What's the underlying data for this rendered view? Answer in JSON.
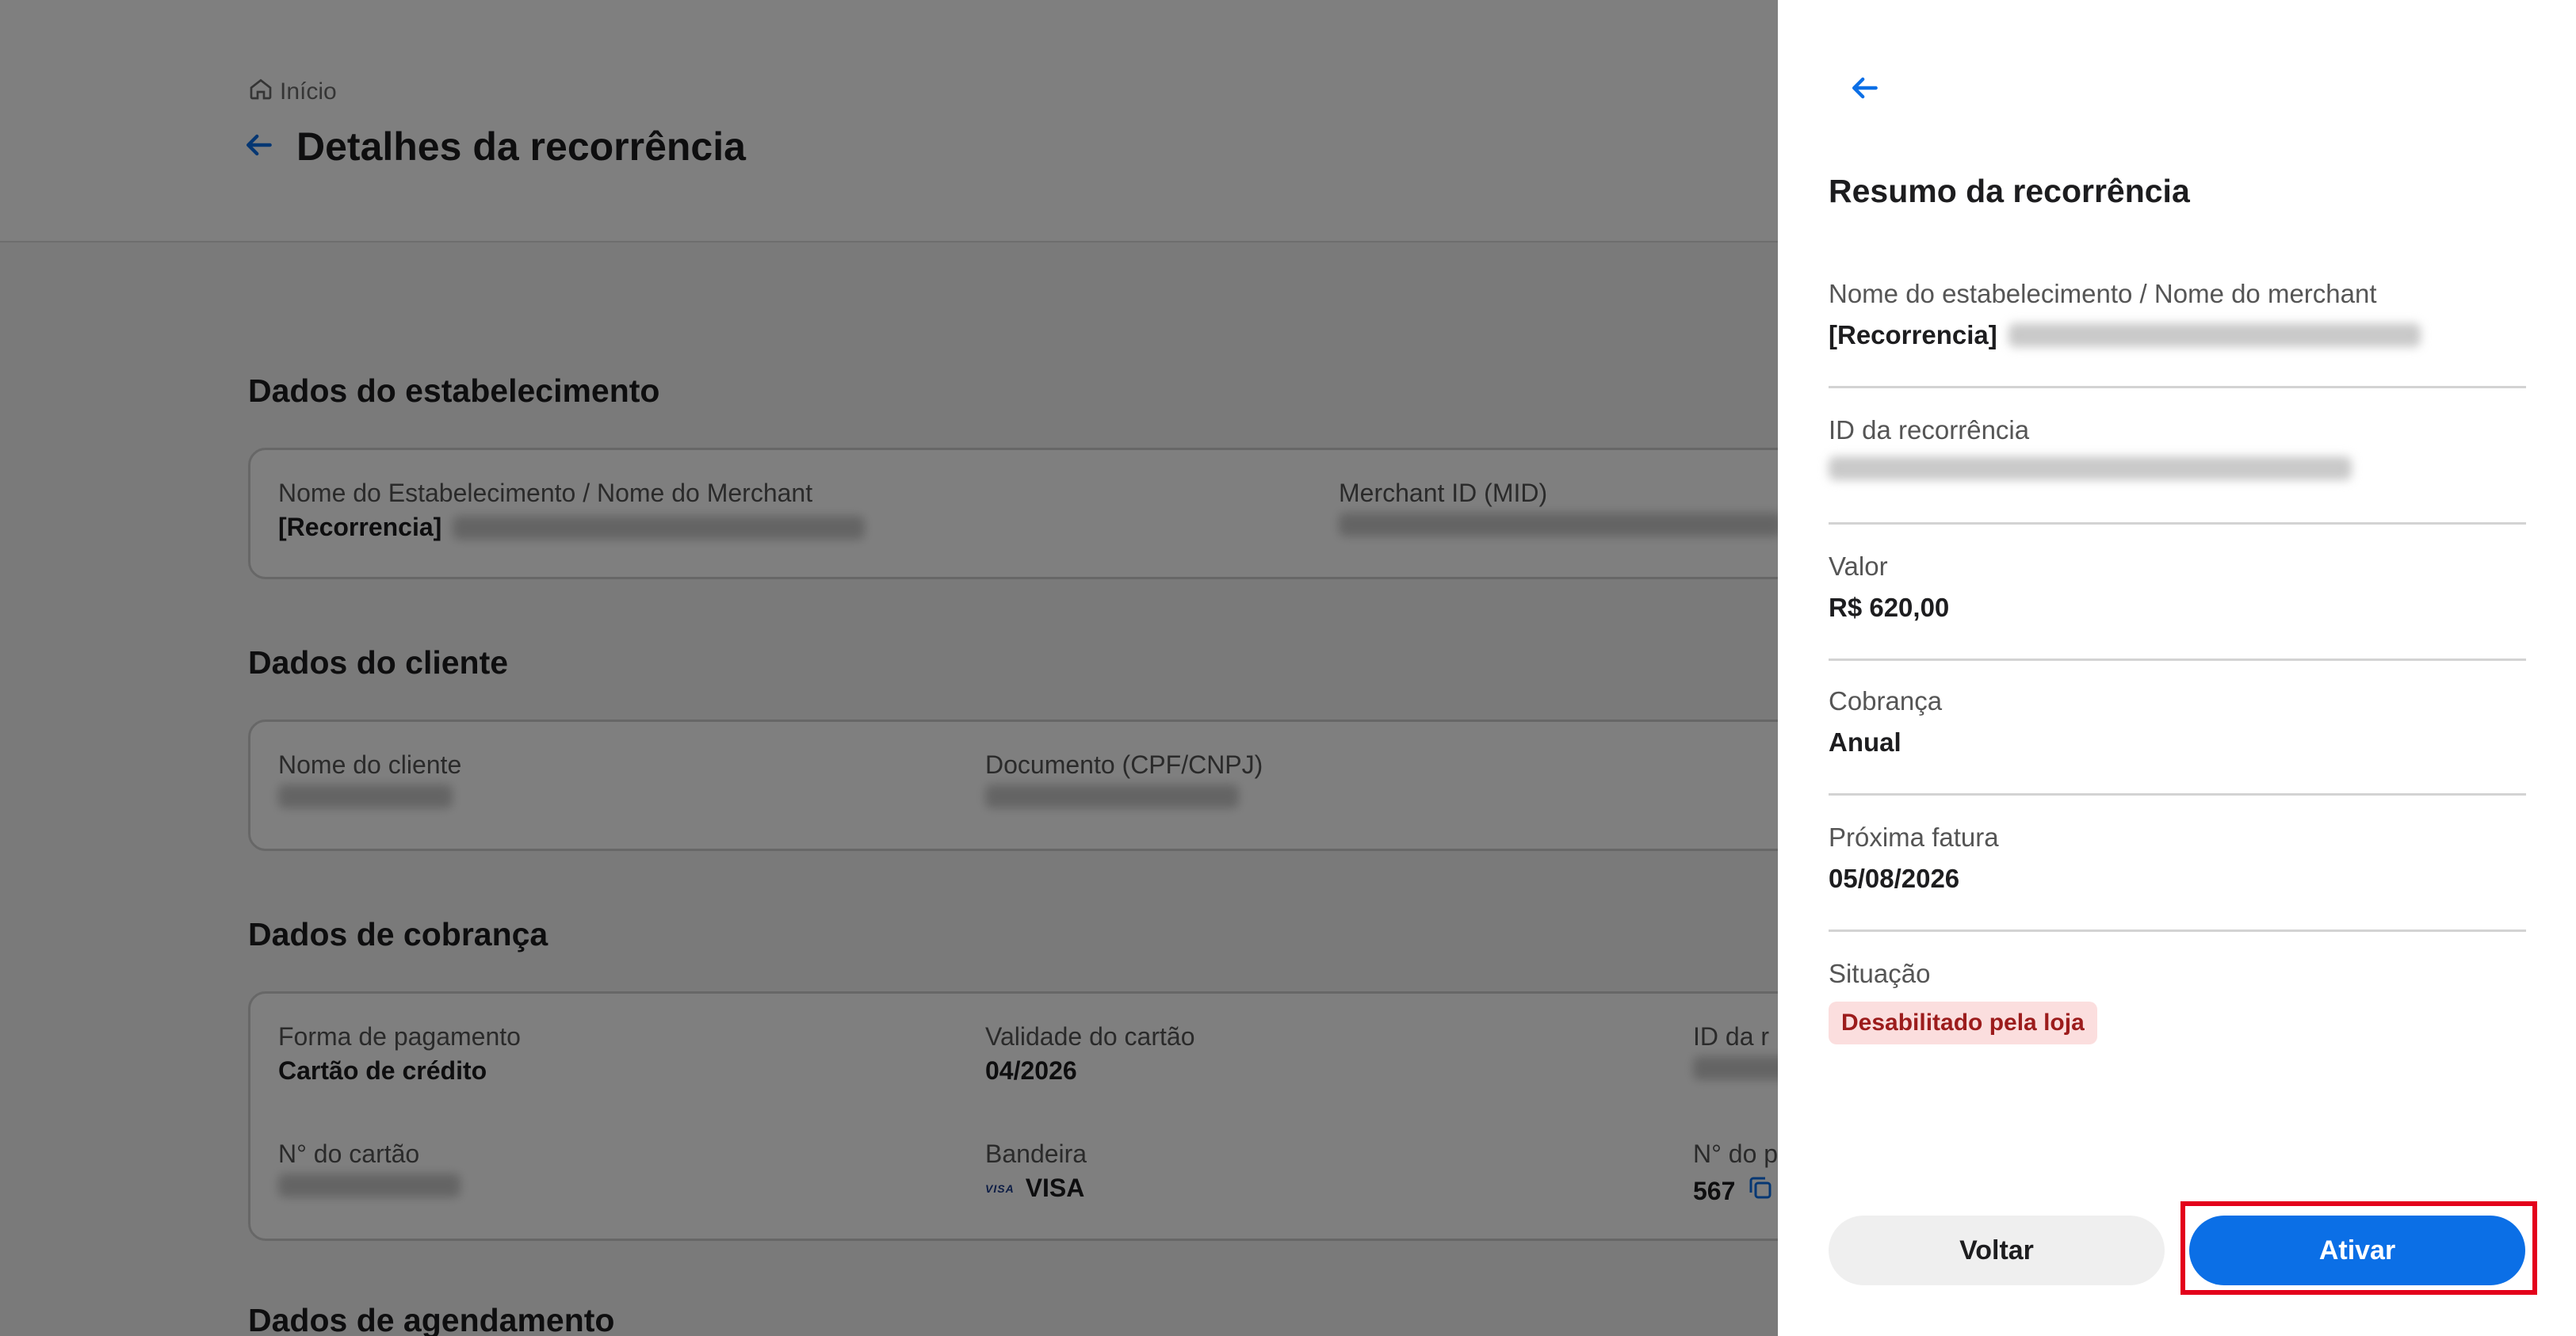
{
  "page": {
    "breadcrumb": "Início",
    "title": "Detalhes da recorrência",
    "sections": {
      "establishment": {
        "title": "Dados do estabelecimento",
        "name_label": "Nome do Estabelecimento / Nome do Merchant",
        "name_prefix": "[Recorrencia]",
        "mid_label": "Merchant ID (MID)"
      },
      "client": {
        "title": "Dados do cliente",
        "name_label": "Nome do cliente",
        "doc_label": "Documento (CPF/CNPJ)"
      },
      "billing": {
        "title": "Dados de cobrança",
        "payment_label": "Forma de pagamento",
        "payment_value": "Cartão de crédito",
        "validity_label": "Validade do cartão",
        "validity_value": "04/2026",
        "id_label": "ID da r",
        "card_number_label": "N° do cartão",
        "brand_label": "Bandeira",
        "brand_value": "VISA",
        "brand_mark": "VISA",
        "third_label": "N° do p",
        "third_value": "567"
      },
      "scheduling": {
        "title": "Dados de agendamento"
      }
    }
  },
  "panel": {
    "title": "Resumo da recorrência",
    "fields": {
      "merchant_label": "Nome do estabelecimento / Nome do merchant",
      "merchant_prefix": "[Recorrencia]",
      "id_label": "ID da recorrência",
      "value_label": "Valor",
      "value": "R$ 620,00",
      "billing_label": "Cobrança",
      "billing_value": "Anual",
      "next_invoice_label": "Próxima fatura",
      "next_invoice_value": "05/08/2026",
      "status_label": "Situação",
      "status_value": "Desabilitado pela loja"
    },
    "buttons": {
      "back": "Voltar",
      "activate": "Ativar"
    }
  },
  "colors": {
    "accent": "#0b6fe6",
    "status_badge_bg": "#fbdede",
    "status_badge_text": "#9c1c1c",
    "highlight": "#e3001b"
  },
  "icons": {
    "breadcrumb": "home-icon",
    "back": "arrow-left-icon",
    "copy": "copy-icon"
  }
}
